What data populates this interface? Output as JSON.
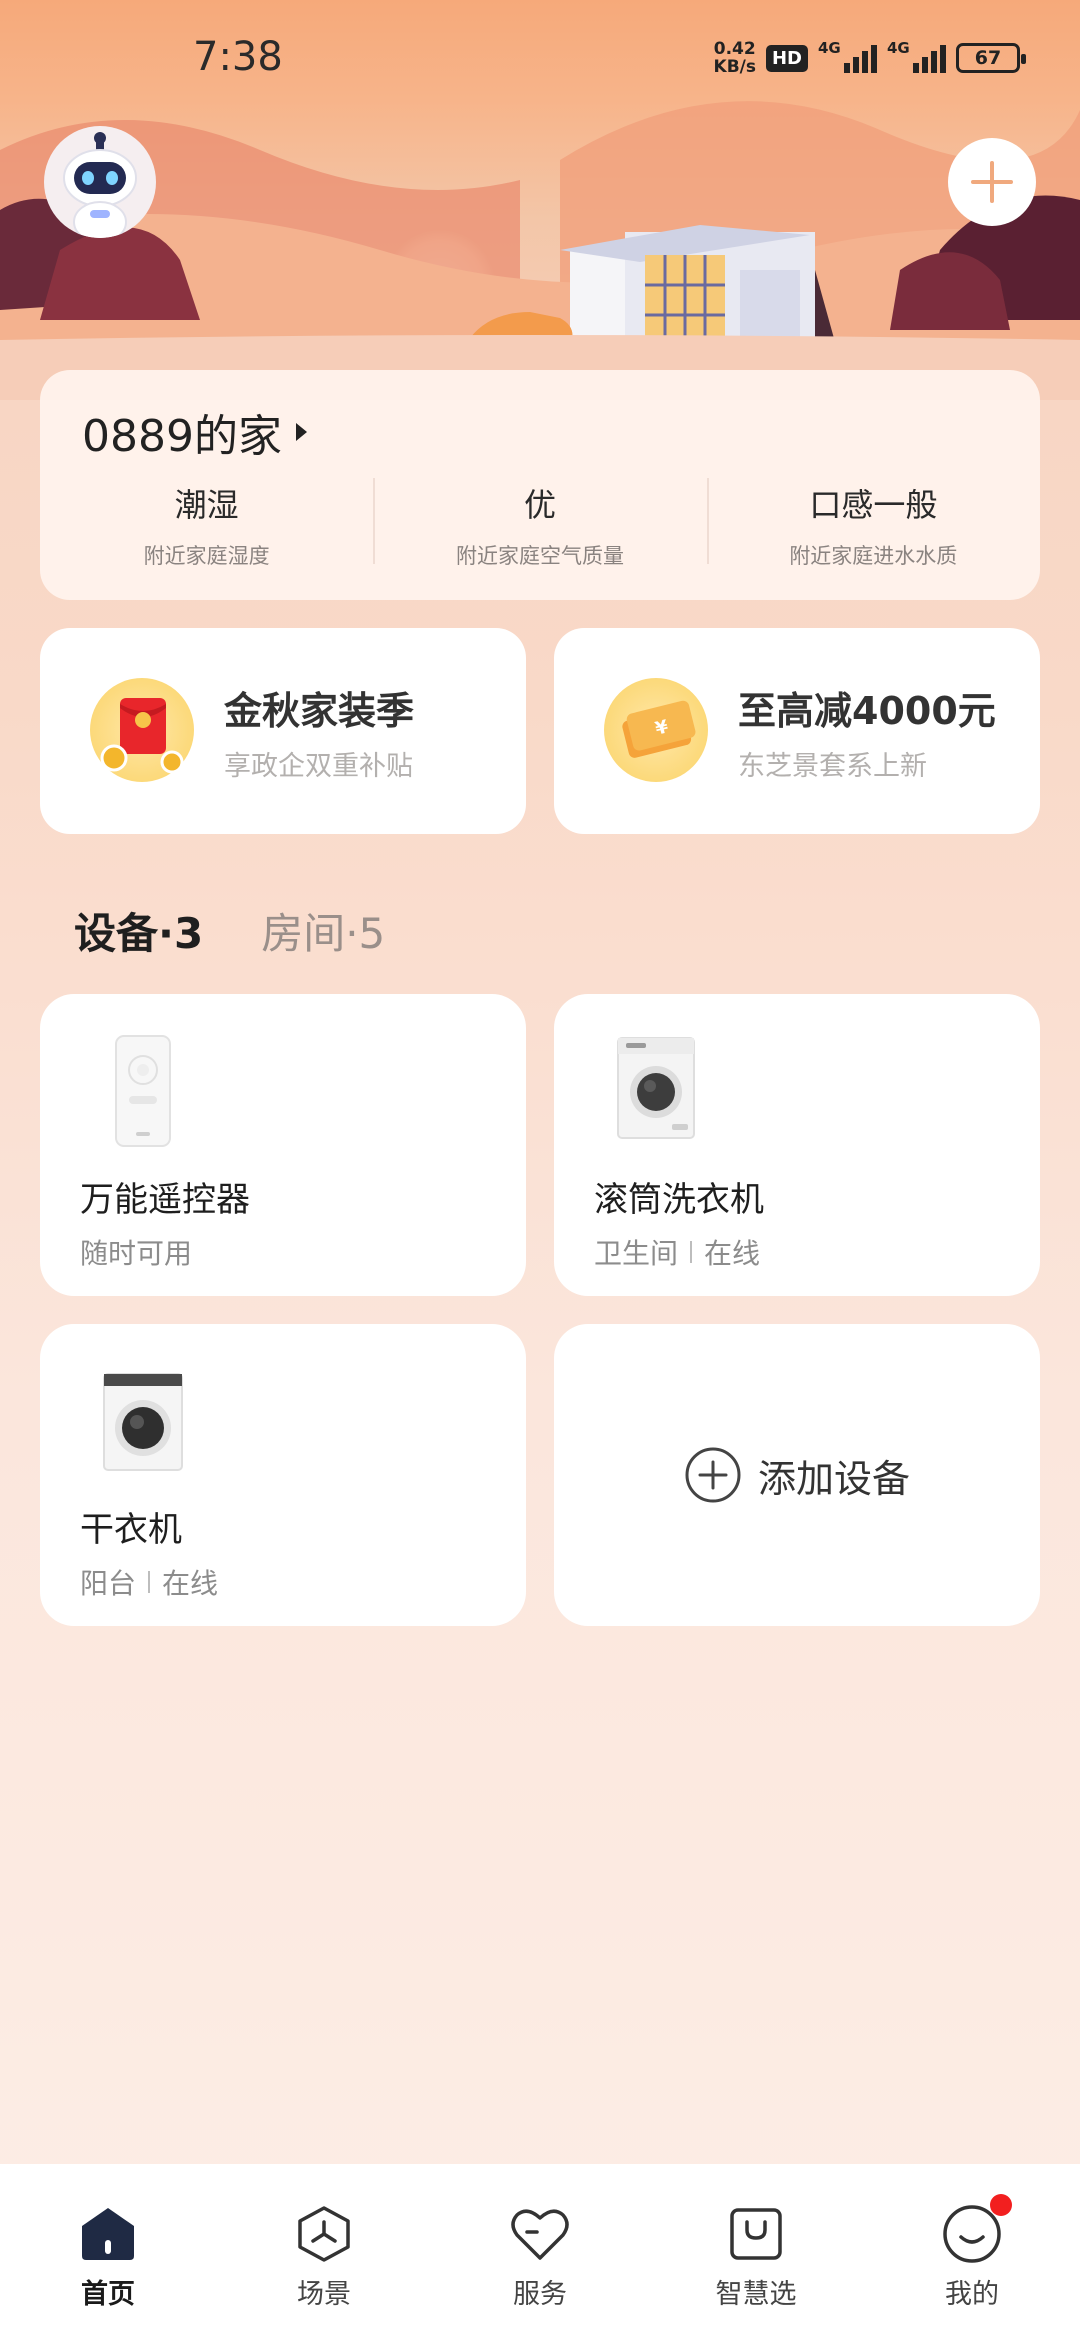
{
  "status_bar": {
    "time": "7:38",
    "net_speed_value": "0.42",
    "net_speed_unit": "KB/s",
    "hd_label": "HD",
    "signal1_label": "4G",
    "signal2_label": "4G",
    "battery": "67"
  },
  "home": {
    "title": "0889的家",
    "metrics": [
      {
        "value": "潮湿",
        "label": "附近家庭湿度"
      },
      {
        "value": "优",
        "label": "附近家庭空气质量"
      },
      {
        "value": "口感一般",
        "label": "附近家庭进水水质"
      }
    ]
  },
  "promos": [
    {
      "title": "金秋家装季",
      "subtitle": "享政企双重补贴",
      "icon": "red-envelope-icon"
    },
    {
      "title": "至高减4000元",
      "subtitle": "东芝景套系上新",
      "icon": "coupon-icon"
    }
  ],
  "tabs": {
    "devices": "设备·3",
    "rooms": "房间·5"
  },
  "devices": [
    {
      "name": "万能遥控器",
      "status": "随时可用",
      "room": ""
    },
    {
      "name": "滚筒洗衣机",
      "room": "卫生间",
      "status": "在线"
    },
    {
      "name": "干衣机",
      "room": "阳台",
      "status": "在线"
    }
  ],
  "add_device": {
    "label": "添加设备"
  },
  "nav": [
    {
      "label": "首页",
      "icon": "home-icon",
      "active": true
    },
    {
      "label": "场景",
      "icon": "scene-icon"
    },
    {
      "label": "服务",
      "icon": "heart-icon"
    },
    {
      "label": "智慧选",
      "icon": "shopping-bag-icon"
    },
    {
      "label": "我的",
      "icon": "profile-icon",
      "badge": true
    }
  ],
  "colors": {
    "accent": "#f6a97a",
    "badge": "#f21f1f",
    "background": "#f9d9c8"
  }
}
